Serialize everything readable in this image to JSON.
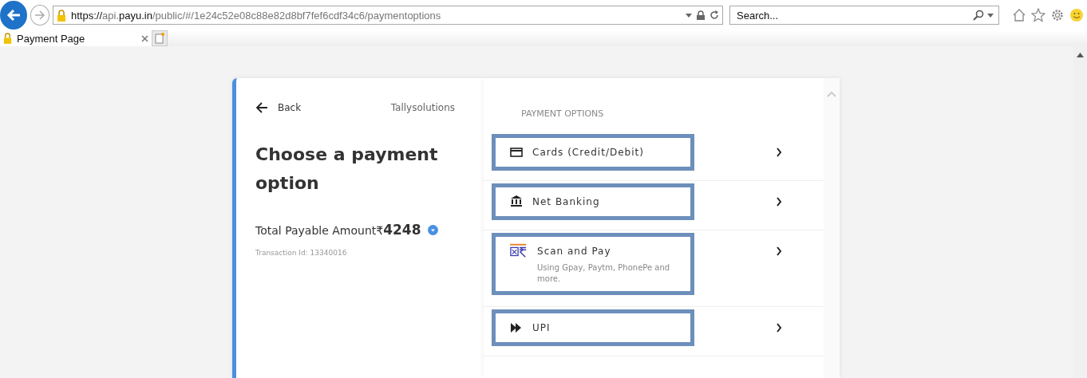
{
  "browser": {
    "url": {
      "scheme": "https://",
      "subdomain": "api.",
      "domain": "payu.in",
      "path": "/public/#/1e24c52e08c88e82d8bf7fef6cdf34c6/paymentoptions"
    },
    "search": {
      "placeholder": "Search..."
    },
    "tabs": [
      {
        "label": "Payment Page",
        "selected": true
      }
    ]
  },
  "summary": {
    "back": "Back",
    "merchant": "Tallysolutions",
    "title": "Choose a payment option",
    "amount_label": "Total Payable Amount",
    "currency": "₹",
    "amount": "4248",
    "transaction": "Transaction Id: 13340016"
  },
  "options_heading": "PAYMENT OPTIONS",
  "options": [
    {
      "kind": "card",
      "label": "Cards (Credit/Debit)",
      "highlighted": true
    },
    {
      "kind": "bank",
      "label": "Net Banking",
      "highlighted": true
    },
    {
      "kind": "qr",
      "label": "Scan and Pay",
      "description": "Using Gpay, Paytm, PhonePe and more.",
      "highlighted": true
    },
    {
      "kind": "upi",
      "label": "UPI",
      "highlighted": true
    }
  ]
}
